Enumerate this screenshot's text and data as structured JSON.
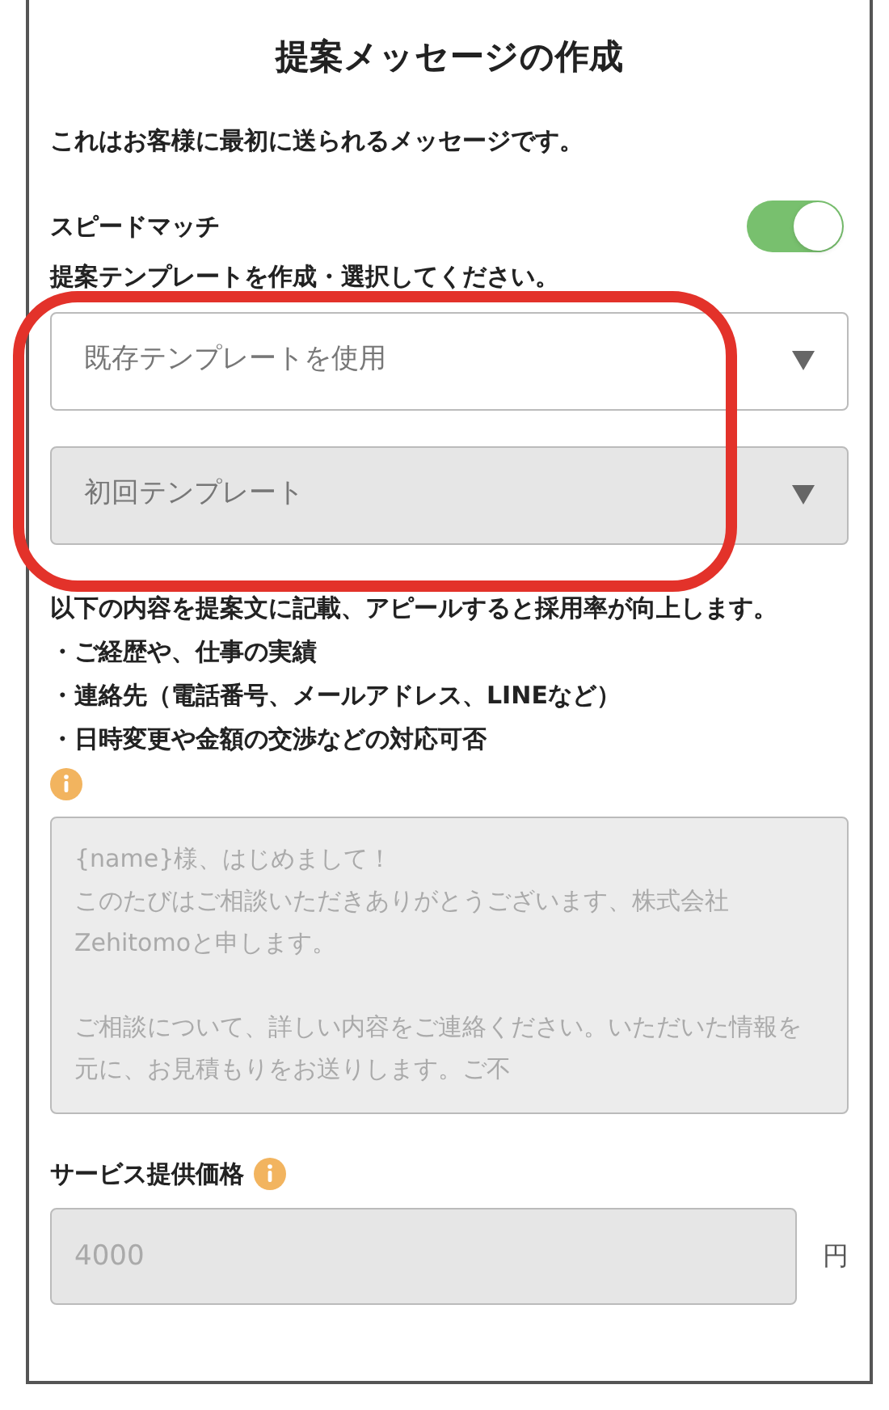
{
  "title": "提案メッセージの作成",
  "intro": "これはお客様に最初に送られるメッセージです。",
  "speed_match": {
    "label": "スピードマッチ",
    "on": true
  },
  "template_prompt": "提案テンプレートを作成・選択してください。",
  "selects": [
    {
      "value": "既存テンプレートを使用",
      "disabled": false
    },
    {
      "value": "初回テンプレート",
      "disabled": true
    }
  ],
  "highlight": {
    "shown": true
  },
  "tips": {
    "lead": "以下の内容を提案文に記載、アピールすると採用率が向上します。",
    "items": [
      "・ご経歴や、仕事の実績",
      "・連絡先（電話番号、メールアドレス、LINEなど）",
      "・日時変更や金額の交渉などの対応可否"
    ]
  },
  "message": {
    "placeholder_paragraphs": [
      [
        "{name}様、はじめまして！",
        "このたびはご相談いただきありがとうございます、株式会社Zehitomoと申します。"
      ],
      [
        "ご相談について、詳しい内容をご連絡ください。いただいた情報を元に、お見積もりをお送りします。ご不"
      ]
    ]
  },
  "price": {
    "label": "サービス提供価格",
    "placeholder": "4000",
    "unit": "円"
  }
}
